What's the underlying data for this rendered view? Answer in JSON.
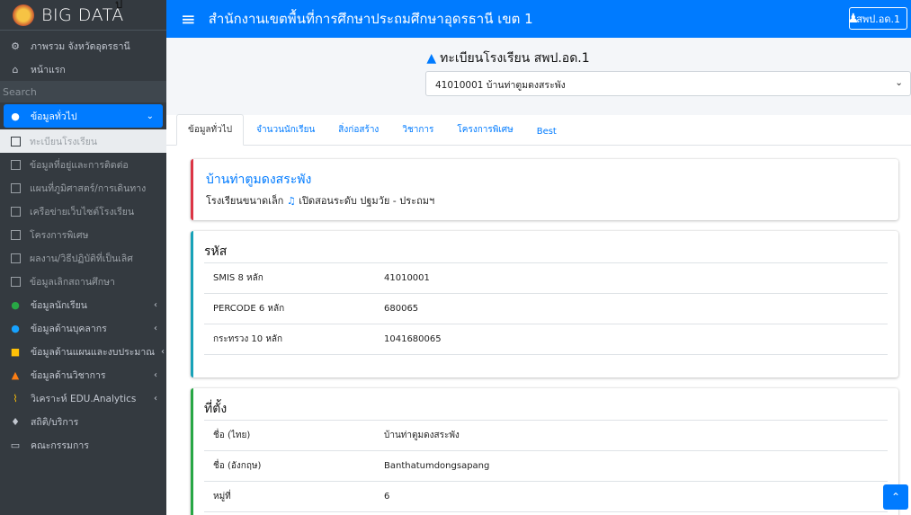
{
  "brand": {
    "name": "BIG DATA",
    "mark": "ป"
  },
  "sidebar": {
    "items_top": [
      {
        "icon": "globe-icon",
        "glyph": "⚙",
        "label": "ภาพรวม จังหวัดอุดรธานี"
      },
      {
        "icon": "home-icon",
        "glyph": "⌂",
        "label": "หน้าแรก"
      }
    ],
    "search_placeholder": "Search",
    "active": {
      "label": "ข้อมูลทั่วไป",
      "arrow": "⌄"
    },
    "sub_items": [
      "ทะเบียนโรงเรียน",
      "ข้อมูลที่อยู่และการติดต่อ",
      "แผนที่ภูมิศาสตร์/การเดินทาง",
      "เครือข่ายเว็บไซต์โรงเรียน",
      "โครงการพิเศษ",
      "ผลงาน/วิธีปฏิบัติที่เป็นเลิศ",
      "ข้อมูลเลิกสถานศึกษา"
    ],
    "items_bottom": [
      {
        "label": "ข้อมูลนักเรียน",
        "arrow": "‹"
      },
      {
        "label": "ข้อมูลด้านบุคลากร",
        "arrow": "‹"
      },
      {
        "label": "ข้อมูลด้านแผนและงบประมาณ",
        "arrow": "‹"
      },
      {
        "label": "ข้อมูลด้านวิชาการ",
        "arrow": "‹"
      },
      {
        "label": "วิเคราะห์ EDU.Analytics",
        "arrow": "‹"
      },
      {
        "label": "สถิติ/บริการ",
        "arrow": ""
      },
      {
        "label": "คณะกรรมการ",
        "arrow": ""
      }
    ]
  },
  "topbar": {
    "title": "สำนักงานเขตพื้นที่การศึกษาประถมศึกษาอุดรธานี เขต 1",
    "button": "สพป.อด.1"
  },
  "header": {
    "title": "ทะเบียนโรงเรียน สพป.อด.1",
    "selected_school": "41010001 บ้านท่าตูมดงสระพัง"
  },
  "tabs": [
    "ข้อมูลทั่วไป",
    "จำนวนนักเรียน",
    "สิ่งก่อสร้าง",
    "วิชาการ",
    "โครงการพิเศษ",
    "Best"
  ],
  "school": {
    "name": "บ้านท่าตูมดงสระพัง",
    "size_text": "โรงเรียนขนาดเล็ก",
    "level_text": "เปิดสอนระดับ ปฐมวัย - ประถมฯ"
  },
  "codes": {
    "title": "รหัส",
    "rows": [
      {
        "k": "SMIS 8 หลัก",
        "v": "41010001"
      },
      {
        "k": "PERCODE 6 หลัก",
        "v": "680065"
      },
      {
        "k": "กระทรวง 10 หลัก",
        "v": "1041680065"
      }
    ]
  },
  "location": {
    "title": "ที่ตั้ง",
    "rows": [
      {
        "k": "ชื่อ (ไทย)",
        "v": "บ้านท่าตูมดงสระพัง"
      },
      {
        "k": "ชื่อ (อังกฤษ)",
        "v": "Banthatumdongsapang"
      },
      {
        "k": "หมู่ที่",
        "v": "6"
      }
    ]
  },
  "colors": {
    "primary": "#007bff",
    "sidebar": "#343a40",
    "danger": "#dc3545",
    "info": "#17a2b8",
    "success": "#28a745"
  }
}
